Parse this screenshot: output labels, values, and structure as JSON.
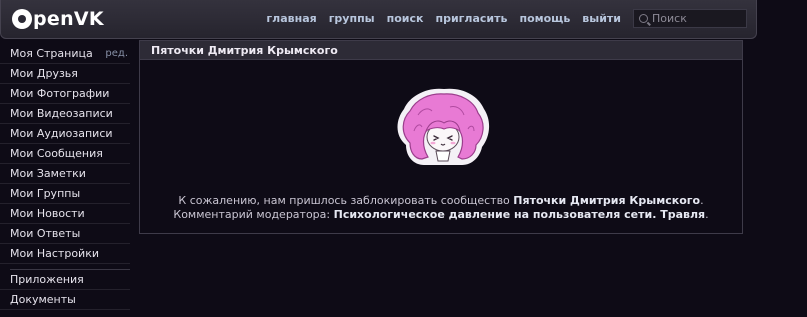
{
  "header": {
    "logo_text": "penVK",
    "nav": [
      "главная",
      "группы",
      "поиск",
      "пригласить",
      "помощь",
      "выйти"
    ],
    "search_placeholder": "Поиск"
  },
  "sidebar": {
    "items": [
      {
        "label": "Моя Страница",
        "edit": "ред."
      },
      {
        "label": "Мои Друзья"
      },
      {
        "label": "Мои Фотографии"
      },
      {
        "label": "Мои Видеозаписи"
      },
      {
        "label": "Мои Аудиозаписи"
      },
      {
        "label": "Мои Сообщения"
      },
      {
        "label": "Мои Заметки"
      },
      {
        "label": "Мои Группы"
      },
      {
        "label": "Мои Новости"
      },
      {
        "label": "Мои Ответы"
      },
      {
        "label": "Мои Настройки"
      }
    ],
    "extra": [
      {
        "label": "Приложения"
      },
      {
        "label": "Документы"
      }
    ]
  },
  "main": {
    "title": "Пяточки Дмитрия Крымского",
    "line1_prefix": "К сожалению, нам пришлось заблокировать сообщество ",
    "line1_name": "Пяточки Дмитрия Крымского",
    "line1_suffix": ".",
    "line2_prefix": "Комментарий модератора: ",
    "line2_reason": "Психологическое давление на пользователя сети. Травля",
    "line2_suffix": "."
  },
  "colors": {
    "background": "#0e0b16",
    "header": "#2d2b36",
    "hair": "#e87ad4",
    "link": "#b8c6dd"
  }
}
